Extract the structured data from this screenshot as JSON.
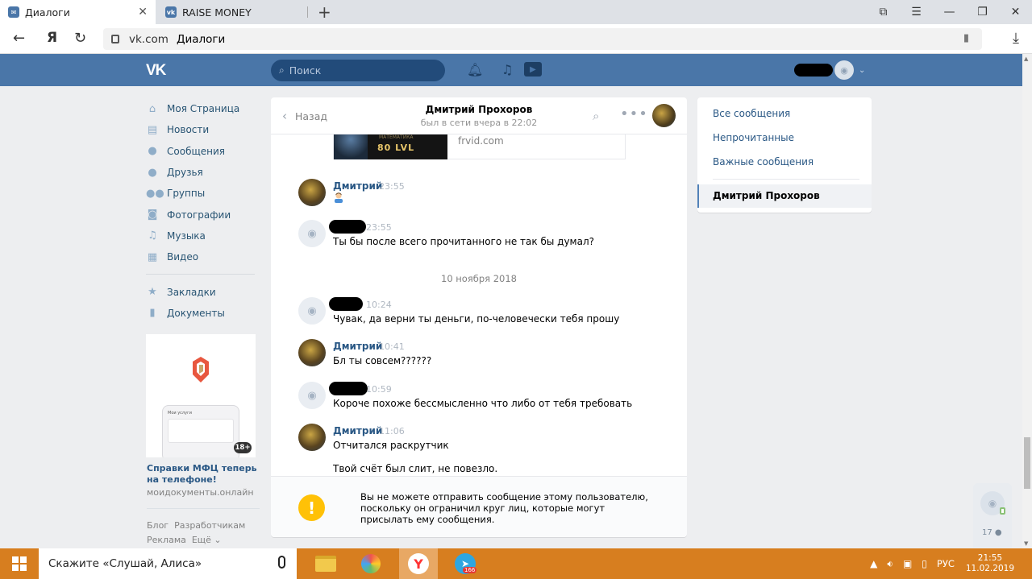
{
  "browser": {
    "tabs": [
      {
        "label": "Диалоги",
        "active": true
      },
      {
        "label": "RAISE MONEY",
        "active": false
      }
    ],
    "url_domain": "vk.com",
    "url_page": "Диалоги",
    "yandex_button": "Я"
  },
  "vk": {
    "logo": "VK",
    "search_placeholder": "Поиск",
    "brand_color": "#4a76a8"
  },
  "left_menu": {
    "items": [
      {
        "label": "Моя Страница",
        "icon": "home-icon"
      },
      {
        "label": "Новости",
        "icon": "news-icon"
      },
      {
        "label": "Сообщения",
        "icon": "messages-icon"
      },
      {
        "label": "Друзья",
        "icon": "friends-icon"
      },
      {
        "label": "Группы",
        "icon": "groups-icon"
      },
      {
        "label": "Фотографии",
        "icon": "photos-icon"
      },
      {
        "label": "Музыка",
        "icon": "music-icon"
      },
      {
        "label": "Видео",
        "icon": "video-icon"
      }
    ],
    "items2": [
      {
        "label": "Закладки",
        "icon": "star-icon"
      },
      {
        "label": "Документы",
        "icon": "document-icon"
      }
    ]
  },
  "ad": {
    "phone_title": "Мои услуги",
    "age": "18+",
    "title": "Справки МФЦ теперь на телефоне!",
    "domain": "моидокументы.онлайн"
  },
  "footer": {
    "blog": "Блог",
    "devs": "Разработчикам",
    "ads": "Реклама",
    "more": "Ещё ⌄"
  },
  "chat": {
    "back": "Назад",
    "peer_name": "Дмитрий Прохоров",
    "peer_status": "был в сети вчера в 22:02",
    "link_card": {
      "thumb_caption": "80 LVL",
      "thumb_small": "МАТЕМАТИКА",
      "domain": "frvid.com"
    },
    "date_separator": "10 ноября 2018",
    "messages": [
      {
        "author": "Дмитрий",
        "time": "23:55",
        "text": "",
        "mine": false
      },
      {
        "author": "",
        "time": "23:55",
        "text": "Ты бы после всего прочитанного не так бы думал?",
        "mine": true
      },
      {
        "author": "",
        "time": "10:24",
        "text": "Чувак, да верни ты деньги, по-человечески тебя прошу",
        "mine": true
      },
      {
        "author": "Дмитрий",
        "time": "10:41",
        "text": "Бл ты совсем??????",
        "mine": false
      },
      {
        "author": "",
        "time": "10:59",
        "text": "Короче похоже бессмысленно что либо от тебя требовать",
        "mine": true
      },
      {
        "author": "Дмитрий",
        "time": "11:06",
        "text": "Отчитался раскрутчик",
        "text2": "Твой счёт был слит, не повезло.",
        "mine": false
      }
    ],
    "warning_icon": "!",
    "warning": "Вы не можете отправить сообщение этому пользователю, поскольку он ограничил круг лиц, которые могут присылать ему сообщения."
  },
  "filters": {
    "all": "Все сообщения",
    "unread": "Непрочитанные",
    "important": "Важные сообщения",
    "active_dialog": "Дмитрий Прохоров"
  },
  "widget": {
    "count": "17"
  },
  "taskbar": {
    "search_text": "Скажите «Слушай, Алиса»",
    "yandex_letter": "Y",
    "telegram_badge": "166",
    "lang": "РУС",
    "time": "21:55",
    "date": "11.02.2019",
    "accent_color": "#d77e1f"
  }
}
